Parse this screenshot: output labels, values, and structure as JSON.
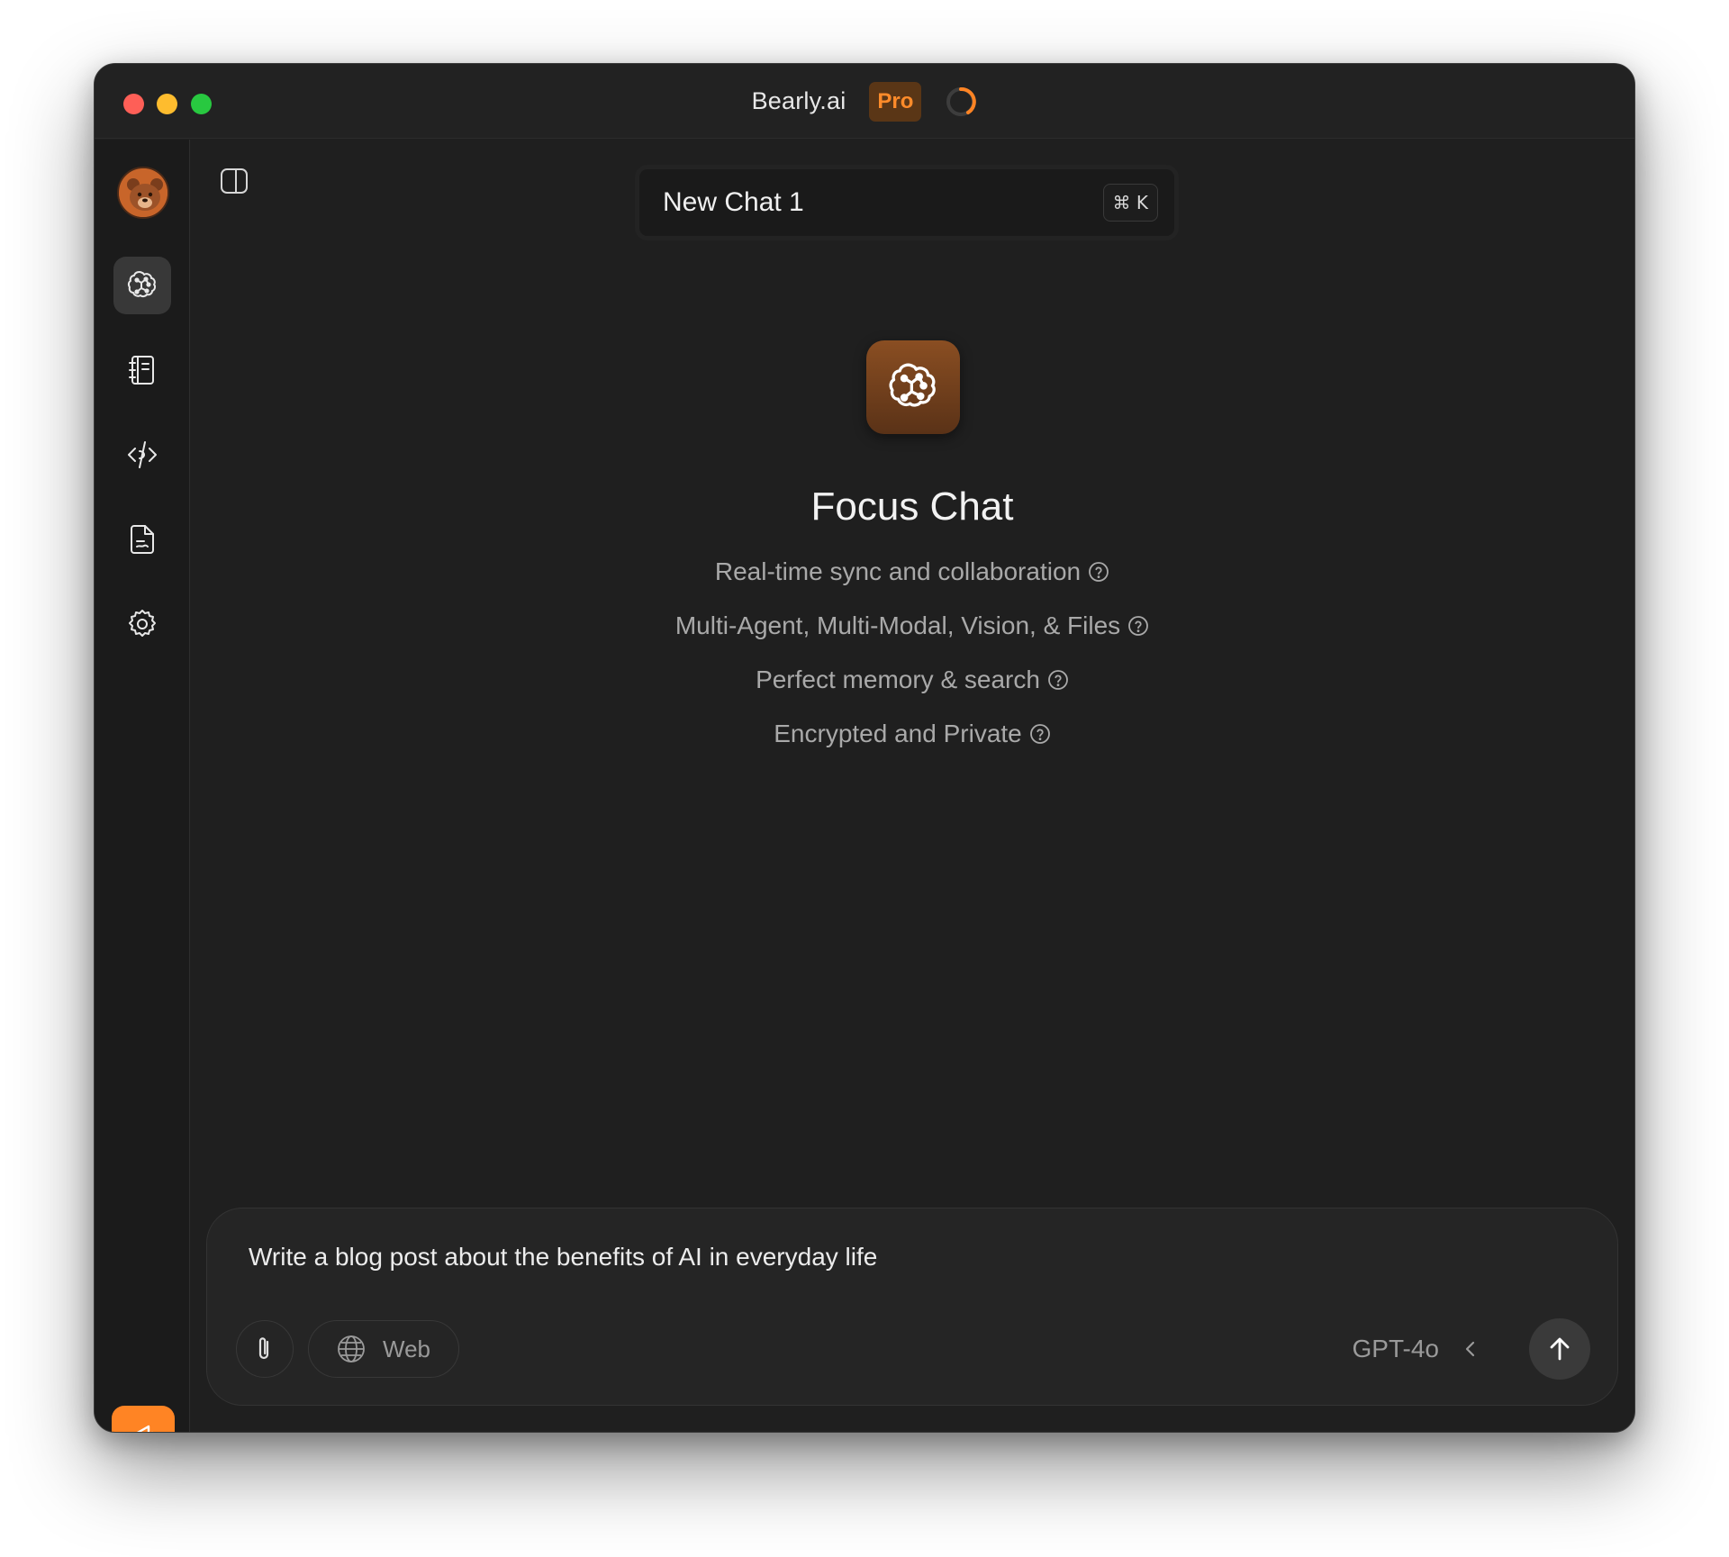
{
  "window": {
    "app_title": "Bearly.ai",
    "badge": "Pro"
  },
  "colors": {
    "accent": "#ff8424",
    "background": "#1f1f1f",
    "sidebar": "#1b1b1b"
  },
  "sidebar": {
    "items": [
      {
        "icon": "brain-chat-icon",
        "active": true
      },
      {
        "icon": "notebook-icon",
        "active": false
      },
      {
        "icon": "code-icon",
        "active": false
      },
      {
        "icon": "document-icon",
        "active": false
      },
      {
        "icon": "gear-icon",
        "active": false
      }
    ],
    "bottom_icon": "megaphone-icon"
  },
  "chat": {
    "title": "New Chat 1",
    "shortcut": "⌘ K"
  },
  "hero": {
    "icon": "brain-chat-icon",
    "title": "Focus Chat",
    "features": [
      "Real-time sync and collaboration",
      "Multi-Agent, Multi-Modal, Vision, & Files",
      "Perfect memory & search",
      "Encrypted and Private"
    ]
  },
  "composer": {
    "value": "Write a blog post about the benefits of AI in everyday life",
    "web_label": "Web",
    "model": "GPT-4o"
  }
}
